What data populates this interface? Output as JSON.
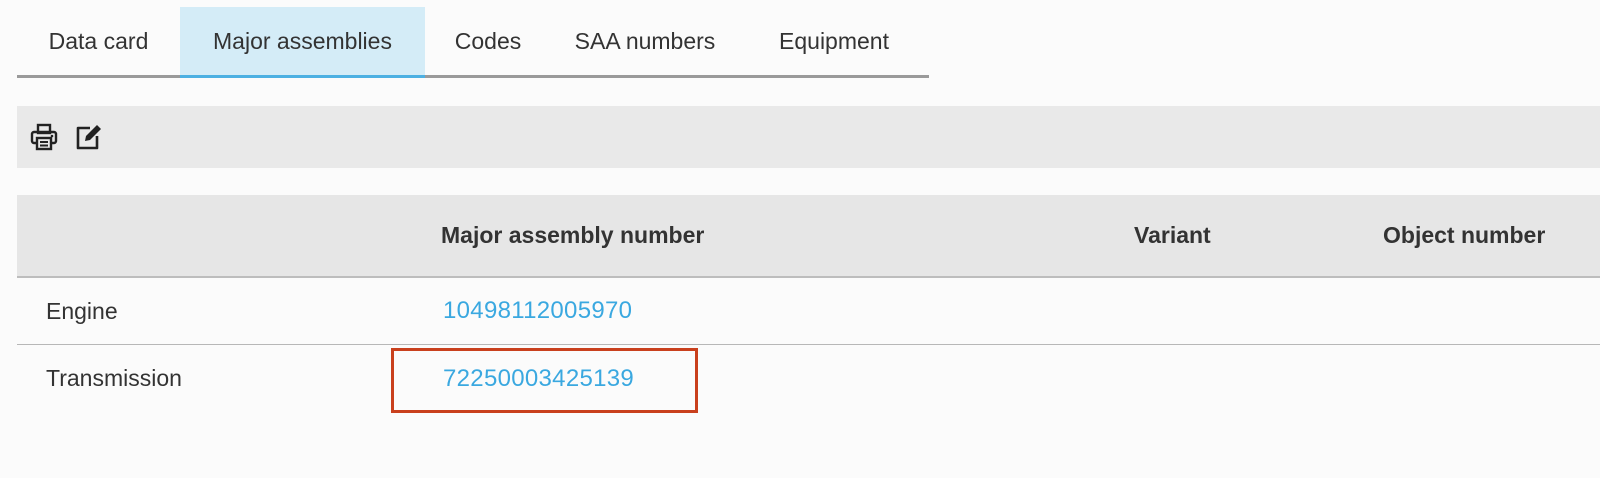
{
  "tabs": [
    {
      "label": "Data card",
      "active": false
    },
    {
      "label": "Major assemblies",
      "active": true
    },
    {
      "label": "Codes",
      "active": false
    },
    {
      "label": "SAA numbers",
      "active": false
    },
    {
      "label": "Equipment",
      "active": false
    }
  ],
  "toolbar": {
    "icons": [
      "printer-icon",
      "edit-icon"
    ]
  },
  "table": {
    "columns": [
      "",
      "Major assembly number",
      "Variant",
      "Object number"
    ],
    "rows": [
      {
        "label": "Engine",
        "number": "10498112005970",
        "variant": "",
        "object": ""
      },
      {
        "label": "Transmission",
        "number": "72250003425139",
        "variant": "",
        "object": ""
      }
    ]
  },
  "colors": {
    "accent": "#4cb0e2",
    "active_tab_bg": "#d4ecf7",
    "link": "#3aa8e0",
    "highlight": "#c9401d"
  }
}
